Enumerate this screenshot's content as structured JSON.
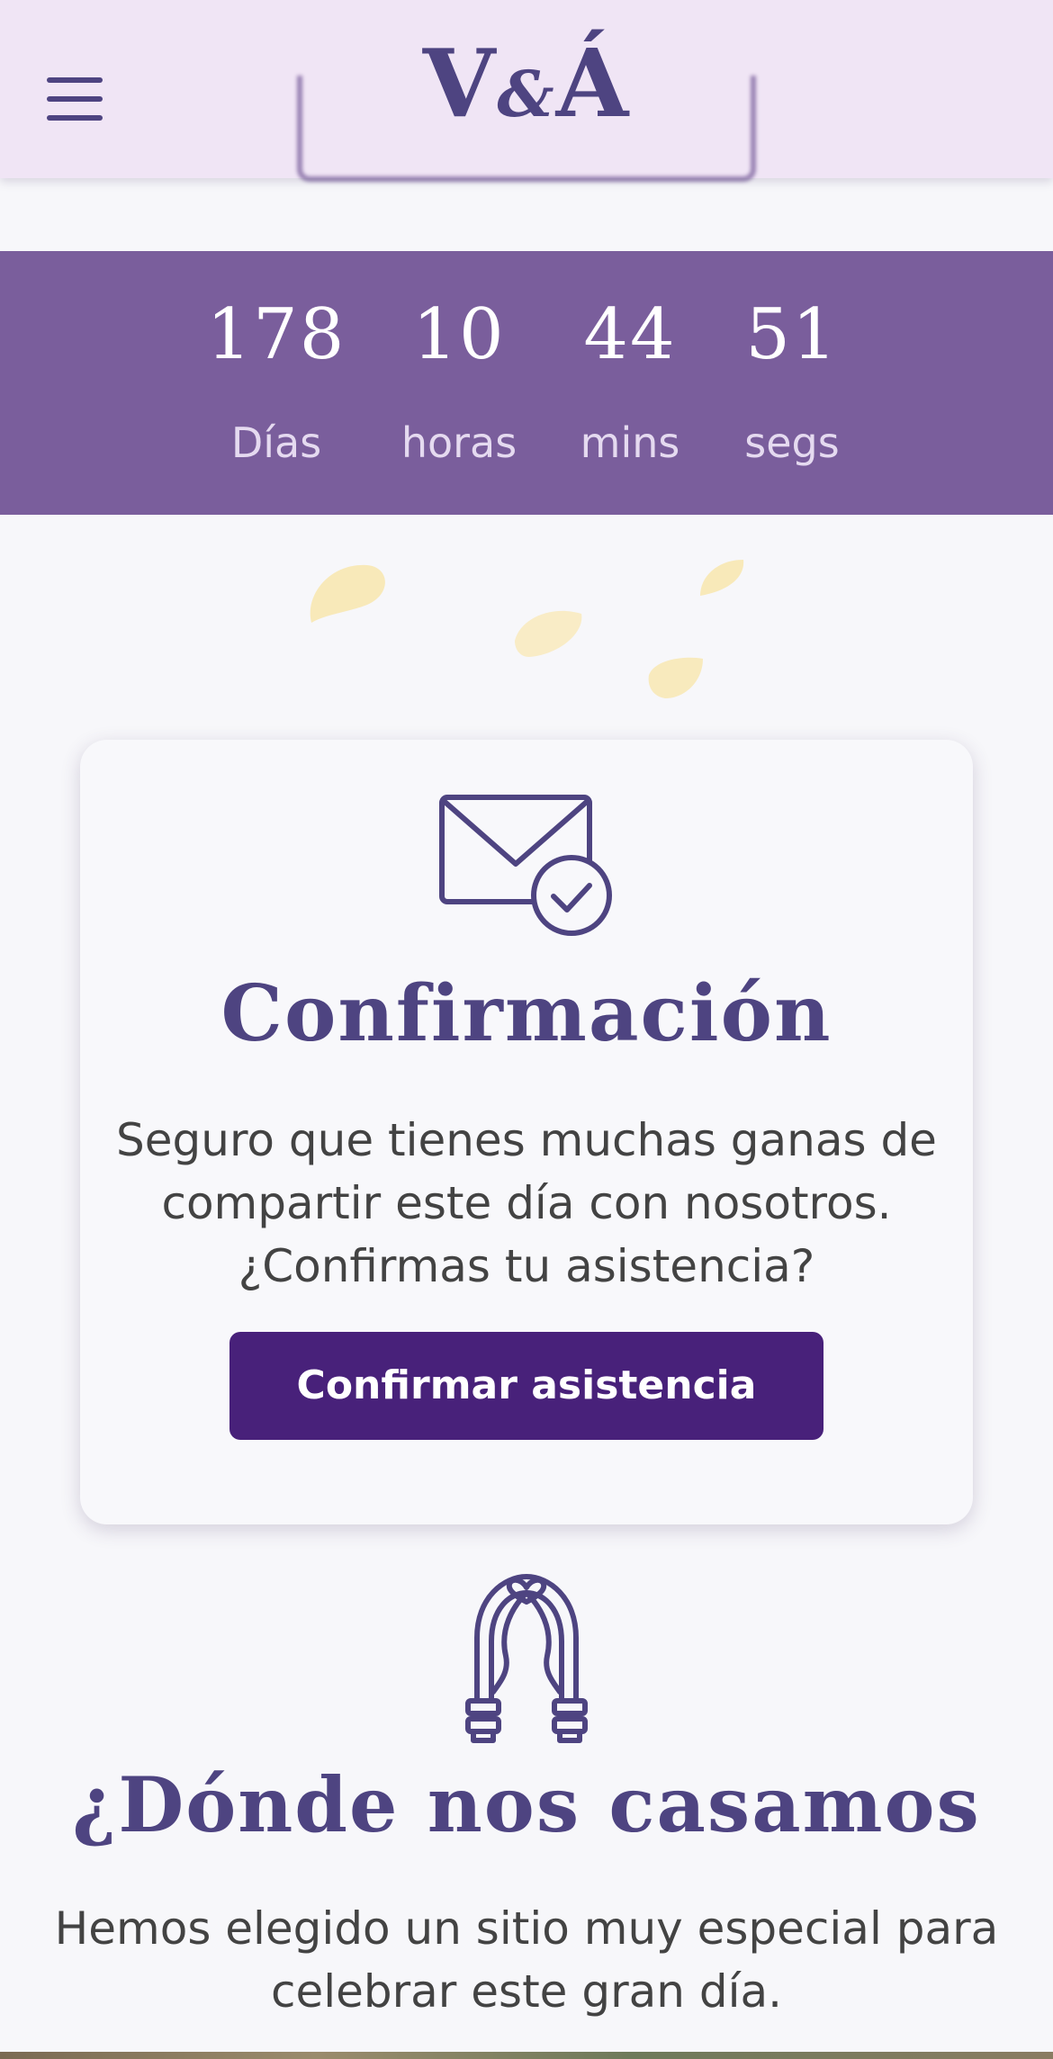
{
  "header": {
    "logo_left": "V",
    "logo_amp": "&",
    "logo_right": "Á",
    "menu_icon": "hamburger-menu-icon"
  },
  "countdown": {
    "items": [
      {
        "value": "178",
        "label": "Días"
      },
      {
        "value": "10",
        "label": "horas"
      },
      {
        "value": "44",
        "label": "mins"
      },
      {
        "value": "51",
        "label": "segs"
      }
    ]
  },
  "confirmation": {
    "icon": "envelope-check-icon",
    "title": "Confirmación",
    "text": "Seguro que tienes muchas ganas de compartir este día con nosotros. ¿Confirmas tu asistencia?",
    "button_label": "Confirmar asistencia"
  },
  "where": {
    "icon": "wedding-arch-icon",
    "title": "¿Dónde nos casamos",
    "text": "Hemos elegido un sitio muy especial para celebrar este gran día."
  },
  "colors": {
    "primary": "#4e4481",
    "header_bg": "#f0e5f5",
    "countdown_bg": "#7a5e9c",
    "button_bg": "#48217a",
    "petal": "#f8e9b8"
  }
}
